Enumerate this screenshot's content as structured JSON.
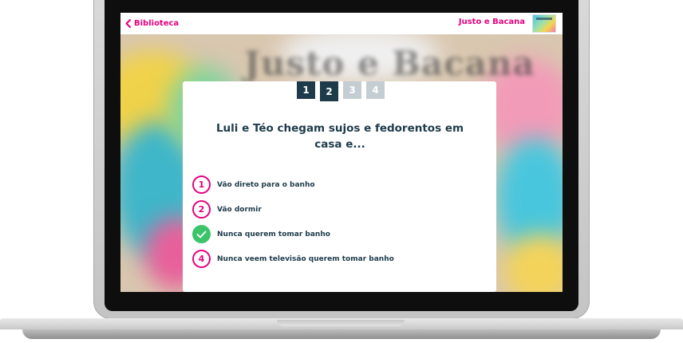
{
  "topbar": {
    "back_label": "Biblioteca",
    "book_title": "Justo e Bacana"
  },
  "background": {
    "blurred_title": "Justo e Bacana"
  },
  "quiz": {
    "steps": [
      "1",
      "2",
      "3",
      "4"
    ],
    "current_step": 2,
    "question": "Luli e Téo chegam sujos e fedorentos em casa e...",
    "options": [
      {
        "number": "1",
        "text": "Vão direto para o banho",
        "state": "default"
      },
      {
        "number": "2",
        "text": "Vão dormir",
        "state": "default"
      },
      {
        "number": "3",
        "text": "Nunca querem tomar banho",
        "state": "correct"
      },
      {
        "number": "4",
        "text": "Nunca veem televisão querem tomar banho",
        "state": "default"
      }
    ]
  },
  "colors": {
    "accent": "#e6007e",
    "dark": "#1d3b4a",
    "step_inactive": "#c4cdd1",
    "correct": "#3cc46a"
  },
  "icons": {
    "back": "chevron-left-icon",
    "correct": "check-icon"
  }
}
